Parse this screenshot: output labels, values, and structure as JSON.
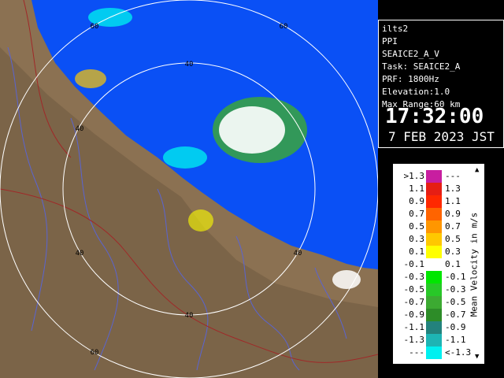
{
  "info": {
    "site": "ilts2",
    "mode": "PPI",
    "product": "SEAICE2_A_V",
    "task": "Task: SEAICE2_A",
    "prf": "PRF: 1800Hz",
    "elevation": "Elevation:1.0",
    "max_range": "Max Range:60 km",
    "time": "17:32:00",
    "date": "7 FEB 2023 JST"
  },
  "legend": {
    "unit": "Mean Velocity in m/s",
    "rows": [
      {
        "left": ">1.3",
        "right": "---",
        "color": "#c81ea0"
      },
      {
        "left": "1.1",
        "right": "1.3",
        "color": "#e61e14"
      },
      {
        "left": "0.9",
        "right": "1.1",
        "color": "#ff2800"
      },
      {
        "left": "0.7",
        "right": "0.9",
        "color": "#ff6400"
      },
      {
        "left": "0.5",
        "right": "0.7",
        "color": "#ff9600"
      },
      {
        "left": "0.3",
        "right": "0.5",
        "color": "#ffc800"
      },
      {
        "left": "0.1",
        "right": "0.3",
        "color": "#ffff00"
      },
      {
        "left": "-0.1",
        "right": "0.1",
        "color": "#ffffff"
      },
      {
        "left": "-0.3",
        "right": "-0.1",
        "color": "#00e600"
      },
      {
        "left": "-0.5",
        "right": "-0.3",
        "color": "#28c828"
      },
      {
        "left": "-0.7",
        "right": "-0.5",
        "color": "#3caa32"
      },
      {
        "left": "-0.9",
        "right": "-0.7",
        "color": "#2d8c28"
      },
      {
        "left": "-1.1",
        "right": "-0.9",
        "color": "#23827d"
      },
      {
        "left": "-1.3",
        "right": "-1.1",
        "color": "#1eb4b4"
      },
      {
        "left": "---",
        "right": "<-1.3",
        "color": "#00f0f0"
      }
    ]
  },
  "map": {
    "range_labels": [
      "60",
      "60",
      "40",
      "40",
      "40",
      "40",
      "40",
      "60"
    ],
    "colors": {
      "sea": "#0050ff",
      "land": "#8c7355",
      "rings": "#ffffff",
      "rivers": "#5a64d2",
      "borders": "#a02828"
    }
  }
}
